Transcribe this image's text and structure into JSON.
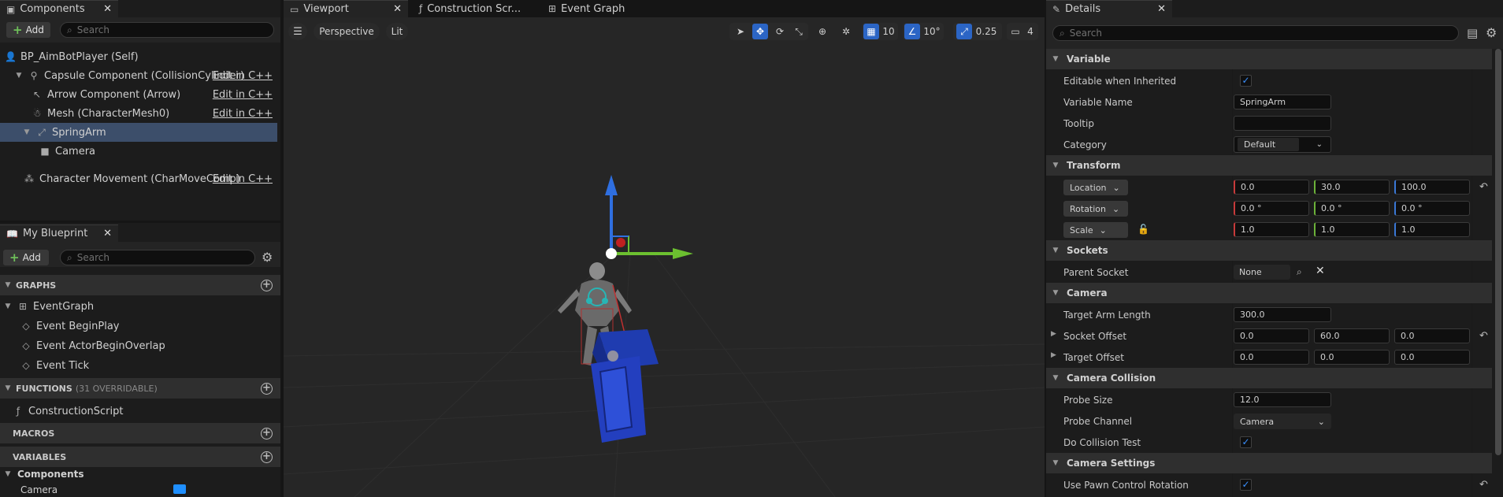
{
  "components_panel": {
    "tab_title": "Components",
    "add_label": "Add",
    "search_placeholder": "Search",
    "tree": [
      {
        "label": "BP_AimBotPlayer (Self)",
        "edit": ""
      },
      {
        "label": "Capsule Component (CollisionCylinder)",
        "edit": "Edit in C++"
      },
      {
        "label": "Arrow Component (Arrow)",
        "edit": "Edit in C++"
      },
      {
        "label": "Mesh (CharacterMesh0)",
        "edit": "Edit in C++"
      },
      {
        "label": "SpringArm",
        "edit": ""
      },
      {
        "label": "Camera",
        "edit": ""
      },
      {
        "label": "Character Movement (CharMoveComp)",
        "edit": "Edit in C++"
      }
    ]
  },
  "my_blueprint": {
    "tab_title": "My Blueprint",
    "add_label": "Add",
    "search_placeholder": "Search",
    "graphs_label": "GRAPHS",
    "event_graph": "EventGraph",
    "events": [
      "Event BeginPlay",
      "Event ActorBeginOverlap",
      "Event Tick"
    ],
    "functions_label": "FUNCTIONS",
    "functions_sub": "(31 OVERRIDABLE)",
    "construction_script": "ConstructionScript",
    "macros_label": "MACROS",
    "variables_label": "VARIABLES",
    "components_label": "Components",
    "camera_var": "Camera"
  },
  "editor_tabs": {
    "viewport": "Viewport",
    "construction": "Construction Scr...",
    "event_graph": "Event Graph"
  },
  "viewport": {
    "perspective": "Perspective",
    "lit": "Lit",
    "grid_snap": "10",
    "rot_snap": "10°",
    "scale_snap": "0.25",
    "camera_speed": "4"
  },
  "details": {
    "tab_title": "Details",
    "search_placeholder": "Search",
    "variable_section": "Variable",
    "editable_when_inherited": "Editable when Inherited",
    "variable_name_label": "Variable Name",
    "variable_name": "SpringArm",
    "tooltip_label": "Tooltip",
    "tooltip_value": "",
    "category_label": "Category",
    "category_value": "Default",
    "transform_section": "Transform",
    "location_label": "Location",
    "location": [
      "0.0",
      "30.0",
      "100.0"
    ],
    "rotation_label": "Rotation",
    "rotation": [
      "0.0 °",
      "0.0 °",
      "0.0 °"
    ],
    "scale_label": "Scale",
    "scale": [
      "1.0",
      "1.0",
      "1.0"
    ],
    "sockets_section": "Sockets",
    "parent_socket_label": "Parent Socket",
    "parent_socket_value": "None",
    "camera_section": "Camera",
    "target_arm_length_label": "Target Arm Length",
    "target_arm_length": "300.0",
    "socket_offset_label": "Socket Offset",
    "socket_offset": [
      "0.0",
      "60.0",
      "0.0"
    ],
    "target_offset_label": "Target Offset",
    "target_offset": [
      "0.0",
      "0.0",
      "0.0"
    ],
    "camera_collision_section": "Camera Collision",
    "probe_size_label": "Probe Size",
    "probe_size": "12.0",
    "probe_channel_label": "Probe Channel",
    "probe_channel": "Camera",
    "do_collision_test_label": "Do Collision Test",
    "camera_settings_section": "Camera Settings",
    "use_pawn_control_rotation_label": "Use Pawn Control Rotation"
  },
  "colors": {
    "selection": "#3c4e6a",
    "accent_blue": "#2b65c5",
    "add_green": "#6fc05a"
  }
}
